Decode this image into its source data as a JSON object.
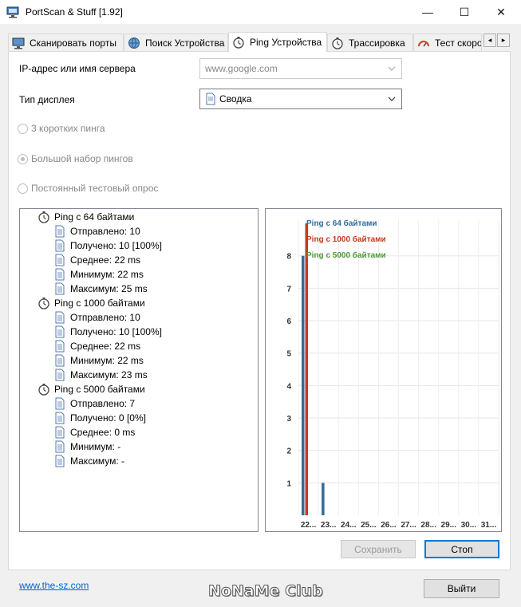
{
  "window": {
    "title": "PortScan & Stuff [1.92]",
    "min_symbol": "—",
    "max_symbol": "☐",
    "close_symbol": "✕"
  },
  "tabs": [
    {
      "label": "Сканировать порты",
      "icon": "monitor-icon"
    },
    {
      "label": "Поиск Устройства",
      "icon": "globe-icon"
    },
    {
      "label": "Ping Устройства",
      "icon": "stopwatch-icon",
      "active": true
    },
    {
      "label": "Трассировка",
      "icon": "stopwatch-icon"
    },
    {
      "label": "Тест скоро",
      "icon": "speedometer-icon"
    }
  ],
  "tab_scroll": {
    "left": "◂",
    "right": "▸"
  },
  "form": {
    "ip_label": "IP-адрес или имя сервера",
    "ip_value": "www.google.com",
    "display_label": "Тип дисплея",
    "display_value": "Сводка",
    "radio_3": "3 коротких пинга",
    "radio_big": "Большой набор пингов",
    "radio_constant": "Постоянный тестовый опрос"
  },
  "tree": [
    {
      "label": "Ping с 64 байтами",
      "children": [
        "Отправлено: 10",
        "Получено: 10 [100%]",
        "Среднее: 22 ms",
        "Минимум: 22 ms",
        "Максимум: 25 ms"
      ]
    },
    {
      "label": "Ping с 1000 байтами",
      "children": [
        "Отправлено: 10",
        "Получено: 10 [100%]",
        "Среднее: 22 ms",
        "Минимум: 22 ms",
        "Максимум: 23 ms"
      ]
    },
    {
      "label": "Ping с 5000 байтами",
      "children": [
        "Отправлено: 7",
        "Получено: 0 [0%]",
        "Среднее: 0 ms",
        "Минимум: -",
        "Максимум: -"
      ]
    }
  ],
  "chart_data": {
    "type": "bar",
    "categories": [
      "22...",
      "23...",
      "24...",
      "25...",
      "26...",
      "27...",
      "28...",
      "29...",
      "30...",
      "31..."
    ],
    "series": [
      {
        "name": "Ping с 64 байтами",
        "color": "#336b99",
        "values": [
          8,
          1,
          0,
          0,
          0,
          0,
          0,
          0,
          0,
          0
        ]
      },
      {
        "name": "Ping с 1000 байтами",
        "color": "#c83a1e",
        "values": [
          9,
          0,
          0,
          0,
          0,
          0,
          0,
          0,
          0,
          0
        ]
      },
      {
        "name": "Ping с 5000 байтами",
        "color": "#4e9a3a",
        "values": [
          0,
          0,
          0,
          0,
          0,
          0,
          0,
          0,
          0,
          0
        ]
      }
    ],
    "yticks": [
      1,
      2,
      3,
      4,
      5,
      6,
      7,
      8
    ],
    "ylim": [
      0,
      9.1
    ],
    "legend_position": "top-left",
    "grid": true
  },
  "buttons": {
    "save": "Сохранить",
    "stop": "Стоп",
    "exit": "Выйти"
  },
  "footer": {
    "link": "www.the-sz.com",
    "watermark": "NoNaMe Club"
  }
}
